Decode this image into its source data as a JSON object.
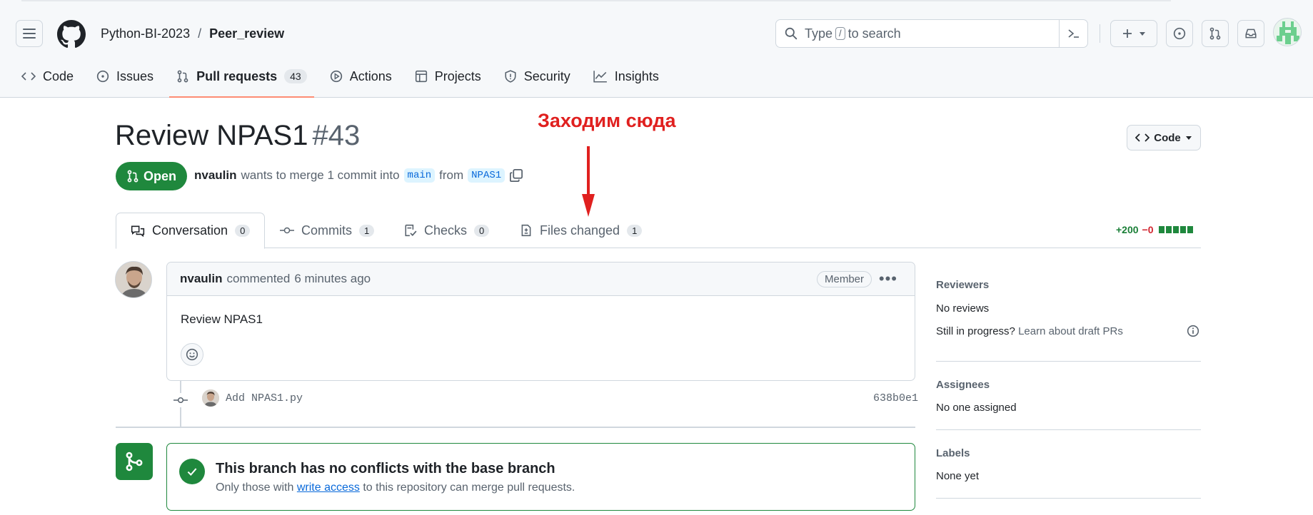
{
  "header": {
    "repo_owner": "Python-BI-2023",
    "separator": "/",
    "repo_name": "Peer_review",
    "search_prefix": "Type",
    "search_key": "/",
    "search_suffix": "to search"
  },
  "nav": {
    "code": "Code",
    "issues": "Issues",
    "pull_requests": "Pull requests",
    "pull_requests_count": "43",
    "actions": "Actions",
    "projects": "Projects",
    "security": "Security",
    "insights": "Insights"
  },
  "pr": {
    "title": "Review NPAS1",
    "number": "#43",
    "state": "Open",
    "author": "nvaulin",
    "meta_text": "wants to merge 1 commit into",
    "base_branch": "main",
    "from_text": "from",
    "head_branch": "NPAS1",
    "code_button": "Code"
  },
  "annotation": {
    "text": "Заходим сюда"
  },
  "tabs": {
    "conversation": "Conversation",
    "conversation_count": "0",
    "commits": "Commits",
    "commits_count": "1",
    "checks": "Checks",
    "checks_count": "0",
    "files_changed": "Files changed",
    "files_changed_count": "1"
  },
  "diffstat": {
    "additions": "+200",
    "deletions": "−0"
  },
  "comment": {
    "author": "nvaulin",
    "action": "commented",
    "time": "6 minutes ago",
    "role": "Member",
    "body": "Review NPAS1"
  },
  "commit": {
    "message": "Add NPAS1.py",
    "sha": "638b0e1"
  },
  "merge": {
    "title": "This branch has no conflicts with the base branch",
    "sub_prefix": "Only those with",
    "sub_link": "write access",
    "sub_suffix": "to this repository can merge pull requests."
  },
  "sidebar": {
    "reviewers_label": "Reviewers",
    "reviewers_value": "No reviews",
    "draft_question": "Still in progress?",
    "draft_link": "Learn about draft PRs",
    "assignees_label": "Assignees",
    "assignees_value": "No one assigned",
    "labels_label": "Labels",
    "labels_value": "None yet"
  },
  "colors": {
    "accent_green": "#1f883d",
    "annotation_red": "#e0201f",
    "link_blue": "#0969da",
    "active_tab_underline": "#fd8c73"
  }
}
